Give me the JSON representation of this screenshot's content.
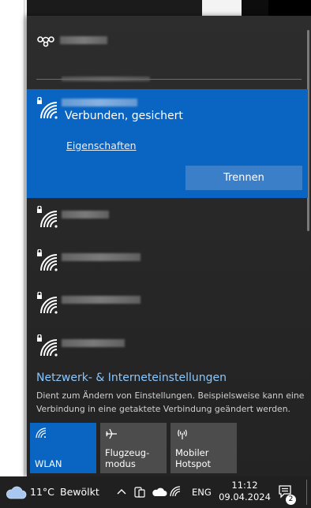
{
  "flyout": {
    "active_network": {
      "status": "Verbunden, gesichert",
      "properties_link": "Eigenschaften",
      "disconnect_button": "Trennen"
    },
    "settings": {
      "title": "Netzwerk- & Interneteinstellungen",
      "description": "Dient zum Ändern von Einstellungen. Beispielsweise kann eine Verbindung in eine getaktete Verbindung geändert werden."
    },
    "tiles": [
      {
        "label": "WLAN",
        "icon": "wifi-icon",
        "active": true
      },
      {
        "label": "Flugzeug-\nmodus",
        "icon": "airplane-icon",
        "active": false
      },
      {
        "label": "Mobiler\nHotspot",
        "icon": "hotspot-icon",
        "active": false
      }
    ]
  },
  "taskbar": {
    "temperature": "11°C",
    "condition": "Bewölkt",
    "language": "ENG",
    "time": "11:12",
    "date": "09.04.2024",
    "notification_count": "2"
  },
  "colors": {
    "accent": "#0a64c2",
    "link": "#8ac7ff",
    "tile_inactive": "#4c4c4c"
  }
}
